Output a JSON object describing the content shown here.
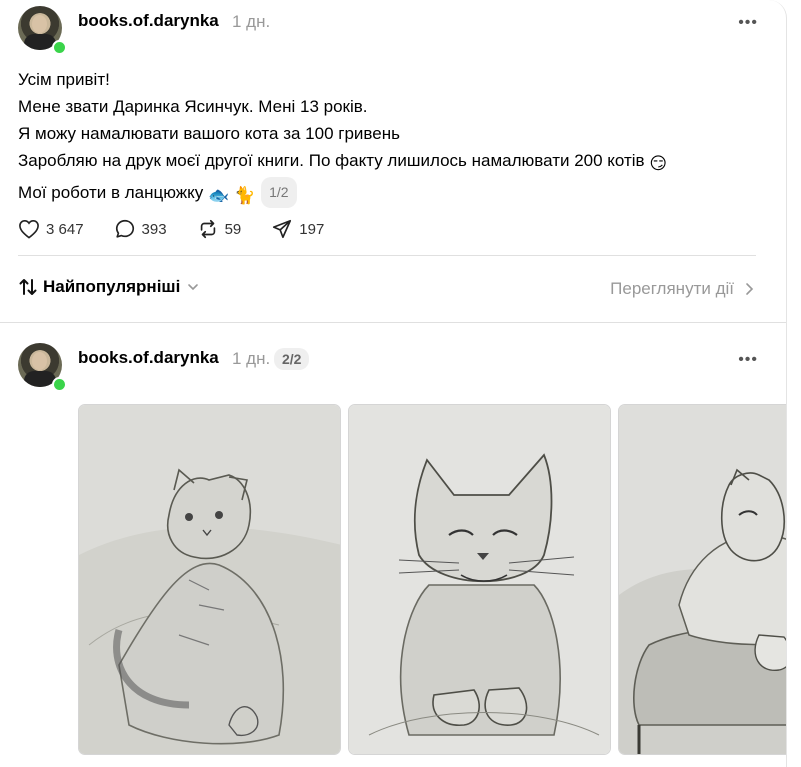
{
  "post1": {
    "username": "books.of.darynka",
    "time": "1 дн.",
    "text_lines": [
      "Усім привіт!",
      "Мене звати Даринка Ясинчук. Мені 13 років.",
      "Я можу намалювати вашого кота за 100 гривень",
      "Заробляю на друк моєї другої книги. По факту лишилось намалювати 200 котів",
      "Мої роботи в ланцюжку"
    ],
    "line4_emoji": "😏",
    "line5_emojis": [
      "🐟",
      "🐈"
    ],
    "thread_chip": "1/2",
    "actions": {
      "likes": "3 647",
      "comments": "393",
      "reposts": "59",
      "shares": "197"
    }
  },
  "sort": {
    "label": "Найпопулярніші",
    "view_activity": "Переглянути дії"
  },
  "post2": {
    "username": "books.of.darynka",
    "time": "1 дн.",
    "thread_chip": "2/2",
    "images": [
      "cat-drawing-1",
      "cat-drawing-2",
      "cat-drawing-3"
    ]
  },
  "icons": [
    "heart-icon",
    "comment-icon",
    "repost-icon",
    "share-icon",
    "more-icon",
    "sort-icon",
    "chevron-down-icon",
    "chevron-right-icon"
  ],
  "colors": {
    "online": "#3ad44a",
    "muted": "#999999",
    "divider": "#e0e0e0"
  }
}
